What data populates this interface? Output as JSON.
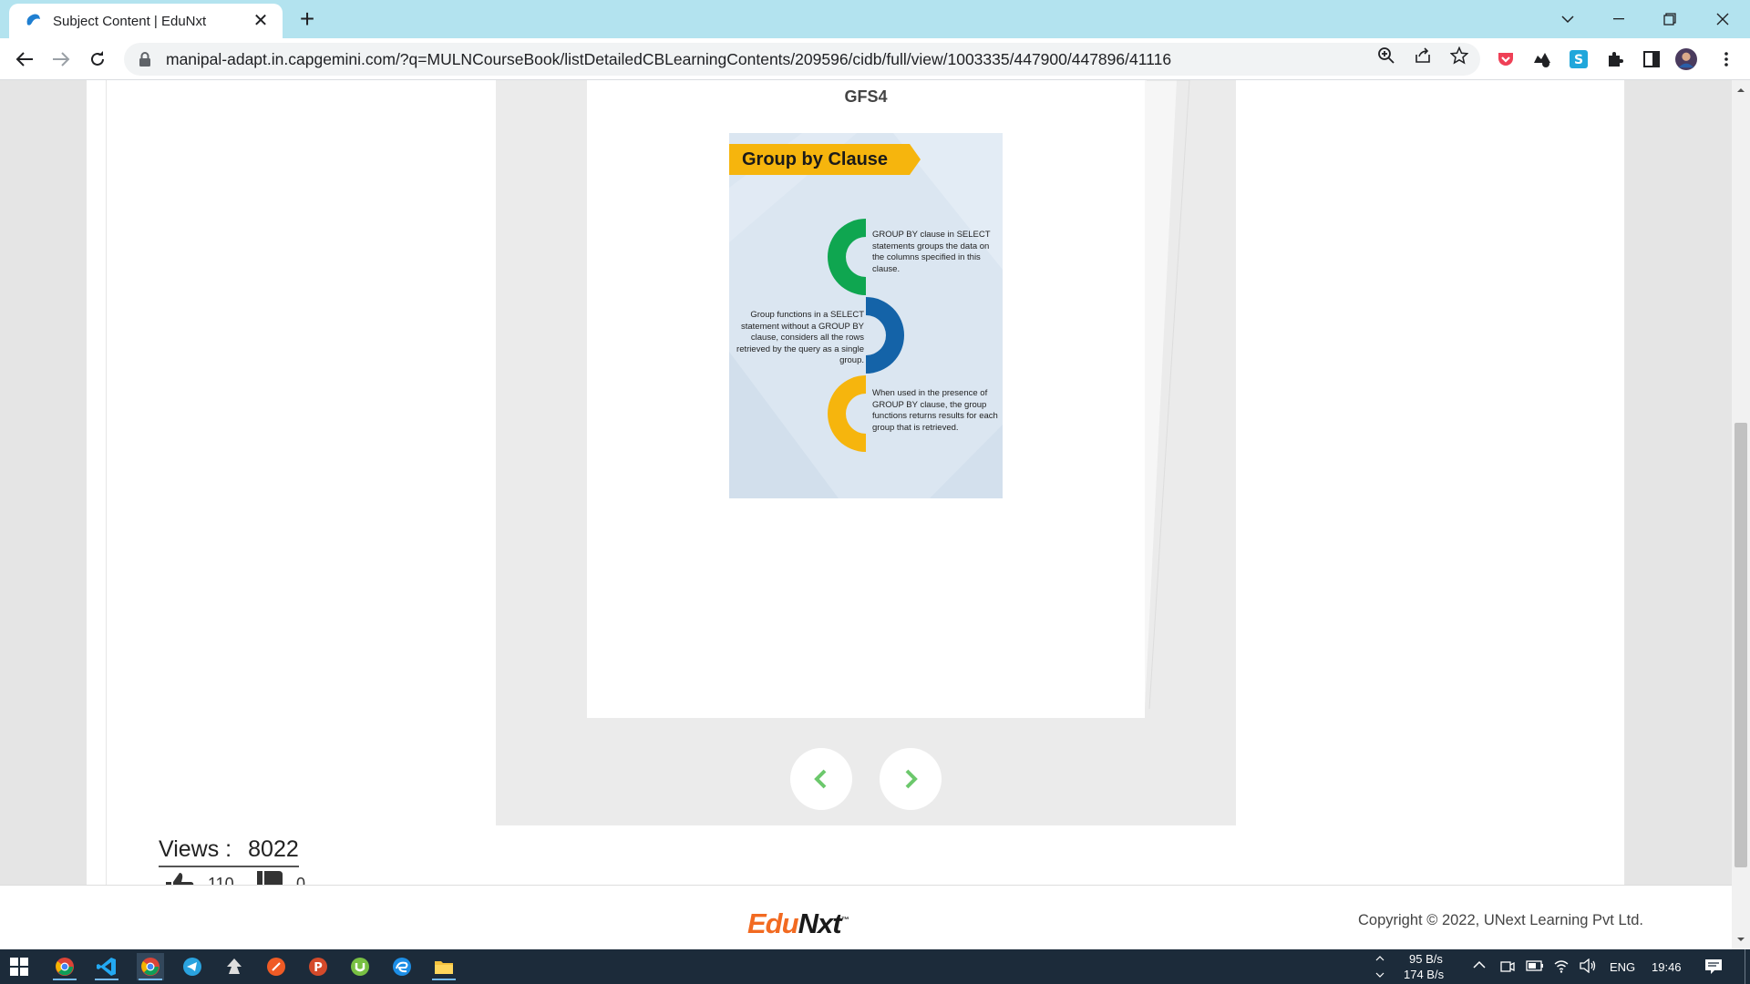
{
  "browser": {
    "tab_title": "Subject Content | EduNxt",
    "url": "manipal-adapt.in.capgemini.com/?q=MULNCourseBook/listDetailedCBLearningContents/209596/cidb/full/view/1003335/447900/447896/41116",
    "icons": [
      "back-arrow-icon",
      "forward-arrow-icon",
      "reload-icon",
      "lock-icon",
      "zoom-icon",
      "share-icon",
      "star-icon",
      "extension-icon",
      "profile-avatar"
    ]
  },
  "slide": {
    "heading": "GFS4",
    "banner": "Group by Clause",
    "steps": [
      "GROUP BY clause in SELECT statements groups the data on the columns specified in this clause.",
      "Group functions in a SELECT statement without a GROUP BY clause, considers all the rows retrieved by the query as a single group.",
      "When used in the presence of GROUP BY clause, the group functions returns results for each group that is retrieved."
    ],
    "colors": {
      "banner": "#f6b50d",
      "step1": "#0fa650",
      "step2": "#1463a8",
      "step3": "#f6b50d",
      "nav_arrow": "#6cc86c"
    }
  },
  "stats": {
    "views_label": "Views :",
    "views_value": "8022",
    "likes_value": "110",
    "dislikes_value": "0"
  },
  "footer": {
    "logo_edu": "Edu",
    "logo_nxt": "Nxt",
    "logo_tm": "™",
    "copyright": "Copyright © 2022, UNext Learning Pvt Ltd."
  },
  "taskbar": {
    "upload_speed": "95 B/s",
    "download_speed": "174 B/s",
    "language": "ENG",
    "time": "19:46"
  }
}
